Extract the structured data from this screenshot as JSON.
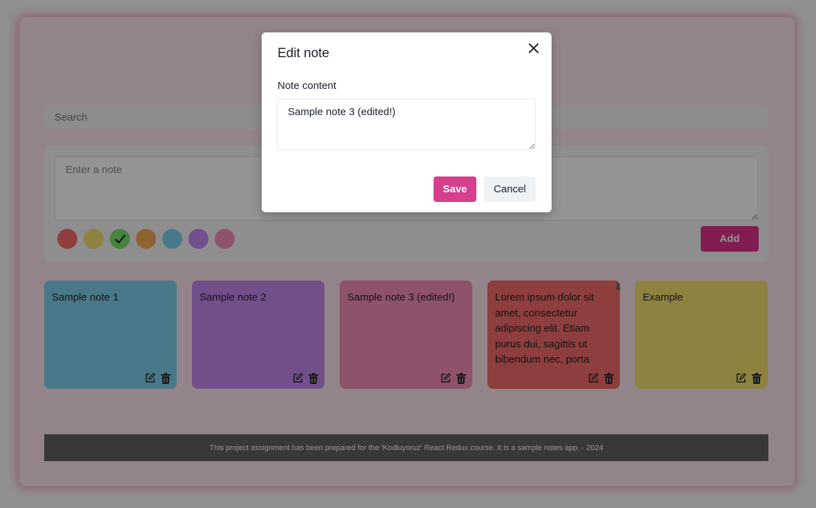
{
  "search": {
    "placeholder": "Search"
  },
  "composer": {
    "placeholder": "Enter a note",
    "add_label": "Add",
    "colors": [
      {
        "name": "red",
        "hex": "#f46c6c",
        "selected": false
      },
      {
        "name": "yellow",
        "hex": "#f3e06f",
        "selected": false
      },
      {
        "name": "green",
        "hex": "#7ee06e",
        "selected": true
      },
      {
        "name": "orange",
        "hex": "#f7aa57",
        "selected": false
      },
      {
        "name": "blue",
        "hex": "#7ed1ec",
        "selected": false
      },
      {
        "name": "purple",
        "hex": "#c388f0",
        "selected": false
      },
      {
        "name": "pink",
        "hex": "#f48fb8",
        "selected": false
      }
    ]
  },
  "notes": [
    {
      "text": "Sample note 1",
      "color": "#7ed1ec"
    },
    {
      "text": "Sample note 2",
      "color": "#c388f0"
    },
    {
      "text": "Sample note 3 (edited!)",
      "color": "#f48fb8"
    },
    {
      "text": "Lorem ipsum dolor sit amet, consectetur adipiscing elit. Etiam purus dui, sagittis ut bibendum nec, porta",
      "color": "#f46c6c"
    },
    {
      "text": "Example",
      "color": "#f3e06f"
    }
  ],
  "footer": {
    "text": "This project assignment has been prepared for the 'Kodluyoruz' React Redux course. It is a sample notes app. - 2024"
  },
  "modal": {
    "title": "Edit note",
    "field_label": "Note content",
    "value": "Sample note 3 (edited!)",
    "save_label": "Save",
    "cancel_label": "Cancel"
  }
}
